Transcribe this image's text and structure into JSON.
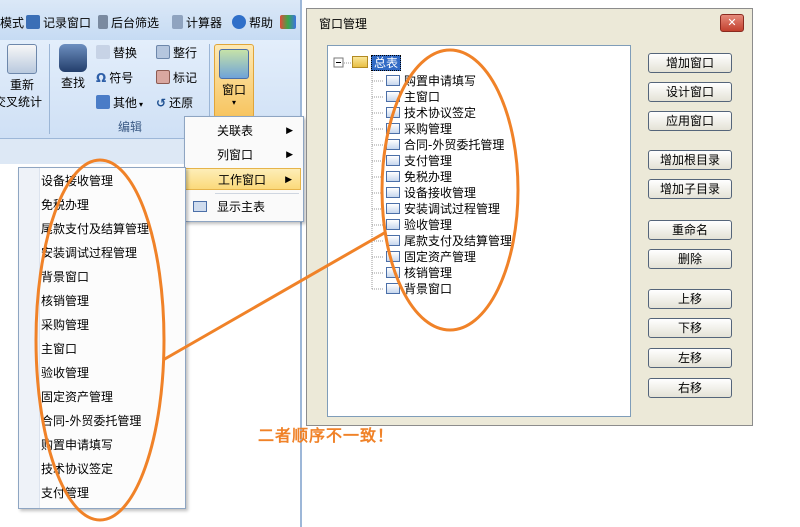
{
  "toolbar": {
    "items": [
      "模式",
      "记录窗口",
      "后台筛选",
      "计算器",
      "帮助"
    ]
  },
  "ribbon": {
    "left_button": {
      "line1": "重新",
      "line2": "交叉统计"
    },
    "find_label": "查找",
    "replace_label": "替换",
    "symbol_label": "符号",
    "other_label": "其他",
    "arrange_label": "整行",
    "mark_label": "标记",
    "restore_label": "还原",
    "edit_group_label": "编辑",
    "window_label": "窗口"
  },
  "menu1": {
    "items": [
      {
        "label": "关联表",
        "arrow": "▶"
      },
      {
        "label": "列窗口",
        "arrow": "▶"
      },
      {
        "label": "工作窗口",
        "arrow": "▶"
      },
      {
        "label": "显示主表",
        "arrow": ""
      }
    ]
  },
  "menu2": {
    "items": [
      "设备接收管理",
      "免税办理",
      "尾款支付及结算管理",
      "安装调试过程管理",
      "背景窗口",
      "核销管理",
      "采购管理",
      "主窗口",
      "验收管理",
      "固定资产管理",
      "合同-外贸委托管理",
      "购置申请填写",
      "技术协议签定",
      "支付管理"
    ]
  },
  "dialog": {
    "title": "窗口管理",
    "close": "✕",
    "tree_root": "总表",
    "tree_items": [
      "购置申请填写",
      "主窗口",
      "技术协议签定",
      "采购管理",
      "合同-外贸委托管理",
      "支付管理",
      "免税办理",
      "设备接收管理",
      "安装调试过程管理",
      "验收管理",
      "尾款支付及结算管理",
      "固定资产管理",
      "核销管理",
      "背景窗口"
    ],
    "buttons": [
      "增加窗口",
      "设计窗口",
      "应用窗口",
      "增加根目录",
      "增加子目录",
      "重命名",
      "删除",
      "上移",
      "下移",
      "左移",
      "右移"
    ]
  },
  "annotation": {
    "text": "二者顺序不一致！",
    "color": "#f08228"
  }
}
